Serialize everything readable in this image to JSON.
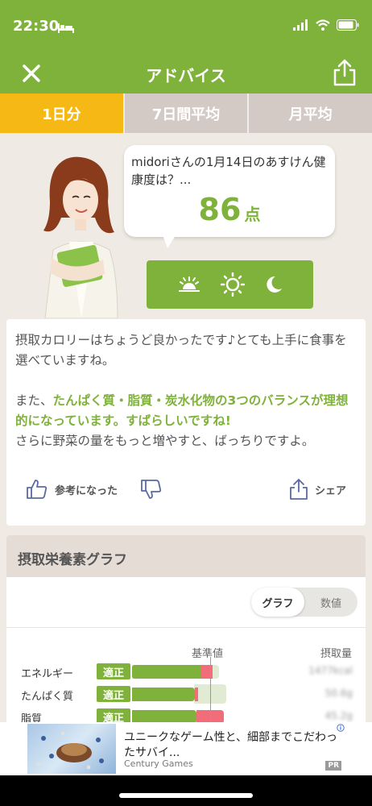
{
  "status": {
    "time": "22:30"
  },
  "nav": {
    "title": "アドバイス"
  },
  "tabs": [
    {
      "label": "1日分",
      "active": true
    },
    {
      "label": "7日間平均",
      "active": false
    },
    {
      "label": "月平均",
      "active": false
    }
  ],
  "bubble": {
    "text": "midoriさんの1月14日のあすけん健康度は？...",
    "score": "86",
    "unit": "点"
  },
  "time_icons": [
    "sunrise-icon",
    "sun-icon",
    "moon-icon"
  ],
  "advice": {
    "line1": "摂取カロリーはちょうど良かったです♪とても上手に食事を選べていますね。",
    "line2_pre": "また、",
    "line2_hl": "たんぱく質・脂質・炭水化物の3つのバランスが理想的になっています。すばらしいですね!",
    "line3": "さらに野菜の量をもっと増やすと、ばっちりですよ。",
    "helpful_label": "参考になった",
    "share_label": "シェア"
  },
  "graph": {
    "title": "摂取栄養素グラフ",
    "toggle_graph": "グラフ",
    "toggle_values": "数値",
    "col_ref": "基準値",
    "col_intake": "摂取量",
    "rows": [
      {
        "label": "エネルギー",
        "badge": "適正",
        "value": "1477kcal"
      },
      {
        "label": "たんぱく質",
        "badge": "適正",
        "value": "50.6g"
      },
      {
        "label": "脂質",
        "badge": "適正",
        "value": "45.2g"
      }
    ]
  },
  "ad": {
    "title": "ユニークなゲーム性と、細部までこだわったサバイ...",
    "advertiser": "Century Games",
    "pr": "PR"
  },
  "colors": {
    "accent": "#7fb23a",
    "tab_active": "#f5b814",
    "tab_inactive": "#d3cac6",
    "over": "#f26d7a"
  }
}
